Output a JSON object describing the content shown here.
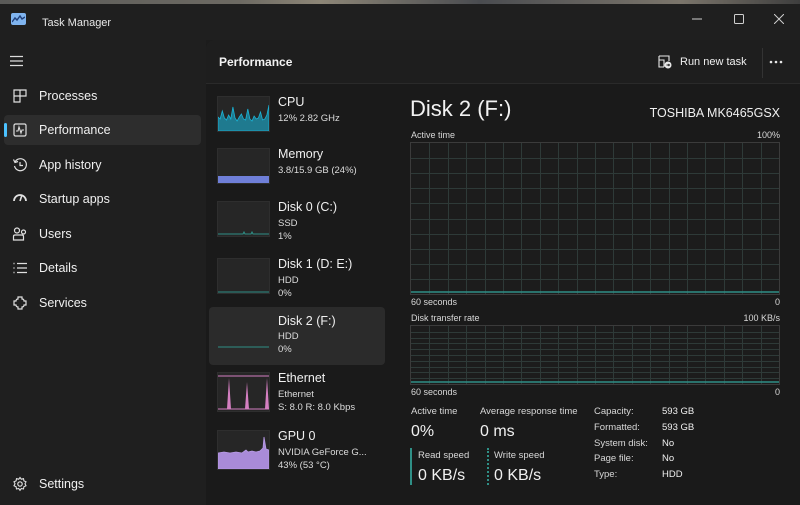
{
  "window": {
    "title": "Task Manager",
    "controls": {
      "minimize": "minimize",
      "maximize": "maximize",
      "close": "close"
    }
  },
  "sidebar": {
    "menu_icon": "hamburger-icon",
    "items": [
      {
        "label": "Processes",
        "icon": "processes-icon",
        "active": false
      },
      {
        "label": "Performance",
        "icon": "performance-icon",
        "active": true
      },
      {
        "label": "App history",
        "icon": "app-history-icon",
        "active": false
      },
      {
        "label": "Startup apps",
        "icon": "startup-apps-icon",
        "active": false
      },
      {
        "label": "Users",
        "icon": "users-icon",
        "active": false
      },
      {
        "label": "Details",
        "icon": "details-icon",
        "active": false
      },
      {
        "label": "Services",
        "icon": "services-icon",
        "active": false
      }
    ],
    "settings_label": "Settings"
  },
  "header": {
    "title": "Performance",
    "run_new_task": "Run new task",
    "more_label": "More options"
  },
  "devices": [
    {
      "name": "CPU",
      "line1": "12% 2.82 GHz",
      "line2": "",
      "color": "#1ab3d6",
      "active": false
    },
    {
      "name": "Memory",
      "line1": "3.8/15.9 GB (24%)",
      "line2": "",
      "color": "#6f7fd8",
      "usage_fraction": 0.24,
      "active": false
    },
    {
      "name": "Disk 0 (C:)",
      "line1": "SSD",
      "line2": "1%",
      "color": "#2f8f86",
      "active": false
    },
    {
      "name": "Disk 1 (D: E:)",
      "line1": "HDD",
      "line2": "0%",
      "color": "#2f8f86",
      "active": false
    },
    {
      "name": "Disk 2 (F:)",
      "line1": "HDD",
      "line2": "0%",
      "color": "#2f8f86",
      "active": true
    },
    {
      "name": "Ethernet",
      "line1": "Ethernet",
      "line2": "S: 8.0  R: 8.0 Kbps",
      "color": "#d47fc1",
      "active": false
    },
    {
      "name": "GPU 0",
      "line1": "NVIDIA GeForce G...",
      "line2": "43% (53 °C)",
      "color": "#a98bd8",
      "active": false
    }
  ],
  "detail": {
    "title": "Disk 2 (F:)",
    "model": "TOSHIBA MK6465GSX",
    "graph1": {
      "label": "Active time",
      "max": "100%",
      "time_label": "60 seconds",
      "min": "0",
      "value": 0
    },
    "graph2": {
      "label": "Disk transfer rate",
      "max": "100 KB/s",
      "time_label": "60 seconds",
      "min": "0",
      "value": 0
    },
    "stats": {
      "active_time_label": "Active time",
      "active_time_value": "0%",
      "avg_response_label": "Average response time",
      "avg_response_value": "0 ms",
      "read_speed_label": "Read speed",
      "read_speed_value": "0 KB/s",
      "write_speed_label": "Write speed",
      "write_speed_value": "0 KB/s"
    },
    "properties": [
      {
        "key": "Capacity:",
        "value": "593 GB"
      },
      {
        "key": "Formatted:",
        "value": "593 GB"
      },
      {
        "key": "System disk:",
        "value": "No"
      },
      {
        "key": "Page file:",
        "value": "No"
      },
      {
        "key": "Type:",
        "value": "HDD"
      }
    ],
    "accent_color": "#2f8f86"
  }
}
